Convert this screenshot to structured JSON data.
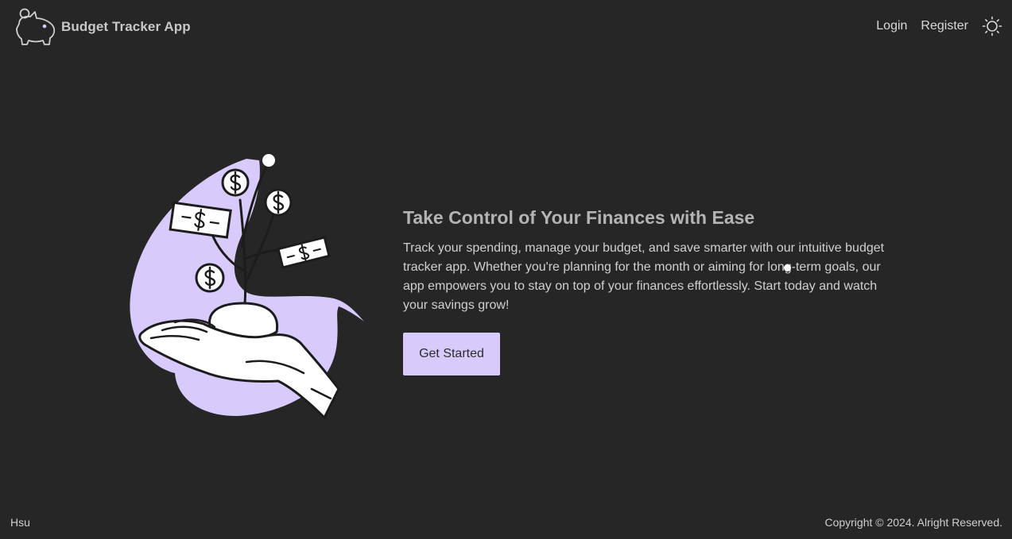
{
  "navbar": {
    "brand_name": "Budget Tracker App",
    "brand_icon": "piggy-bank-icon",
    "login_label": "Login",
    "register_label": "Register",
    "theme_icon": "sun-icon"
  },
  "hero": {
    "title": "Take Control of Your Finances with Ease",
    "description": "Track your spending, manage your budget, and save smarter with our intuitive budget tracker app. Whether you're planning for the month or aiming for long-term goals, our app empowers you to stay on top of your finances effortlessly. Start today and watch your savings grow!",
    "cta_label": "Get Started",
    "illustration": "hand-growing-money-plant-illustration"
  },
  "footer": {
    "left_text": "Hsu",
    "copyright": "Copyright © 2024. Alright Reserved."
  },
  "colors": {
    "background": "#262626",
    "accent": "#d8cbfb",
    "text": "#d4d4d4"
  }
}
